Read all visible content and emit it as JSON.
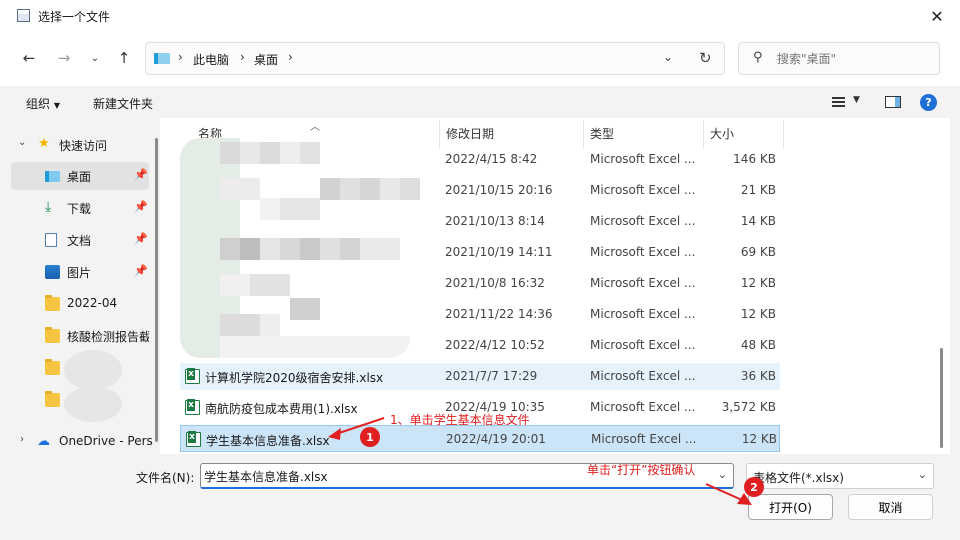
{
  "window": {
    "title": "选择一个文件"
  },
  "address": {
    "crumbs": [
      "此电脑",
      "桌面"
    ],
    "search_placeholder": "搜索\"桌面\""
  },
  "toolbar": {
    "organize": "组织",
    "new_folder": "新建文件夹"
  },
  "nav": {
    "quick_access": "快速访问",
    "items": [
      {
        "label": "桌面",
        "icon": "desktop-icon",
        "pinned": true
      },
      {
        "label": "下载",
        "icon": "download-icon",
        "pinned": true
      },
      {
        "label": "文档",
        "icon": "document-icon",
        "pinned": true
      },
      {
        "label": "图片",
        "icon": "picture-icon",
        "pinned": true
      },
      {
        "label": "2022-04",
        "icon": "folder-icon",
        "pinned": false
      },
      {
        "label": "核酸检测报告截",
        "icon": "folder-icon",
        "pinned": false
      }
    ],
    "onedrive": "OneDrive - Pers"
  },
  "columns": {
    "name": "名称",
    "date": "修改日期",
    "type": "类型",
    "size": "大小"
  },
  "files": [
    {
      "name": "",
      "date": "2022/4/15 8:42",
      "type": "Microsoft Excel ...",
      "size": "146 KB"
    },
    {
      "name": "",
      "date": "2021/10/15 20:16",
      "type": "Microsoft Excel ...",
      "size": "21 KB"
    },
    {
      "name": "",
      "date": "2021/10/13 8:14",
      "type": "Microsoft Excel ...",
      "size": "14 KB"
    },
    {
      "name": "",
      "date": "2021/10/19 14:11",
      "type": "Microsoft Excel ...",
      "size": "69 KB"
    },
    {
      "name": "",
      "date": "2021/10/8 16:32",
      "type": "Microsoft Excel ...",
      "size": "12 KB"
    },
    {
      "name": "",
      "date": "2021/11/22 14:36",
      "type": "Microsoft Excel ...",
      "size": "12 KB"
    },
    {
      "name": "",
      "date": "2022/4/12 10:52",
      "type": "Microsoft Excel ...",
      "size": "48 KB"
    },
    {
      "name": "计算机学院2020级宿舍安排.xlsx",
      "date": "2021/7/7 17:29",
      "type": "Microsoft Excel ...",
      "size": "36 KB"
    },
    {
      "name": "南航防疫包成本费用(1).xlsx",
      "date": "2022/4/19 10:35",
      "type": "Microsoft Excel ...",
      "size": "3,572 KB"
    },
    {
      "name": "学生基本信息准备.xlsx",
      "date": "2022/4/19 20:01",
      "type": "Microsoft Excel ...",
      "size": "12 KB"
    }
  ],
  "bottom": {
    "filename_label": "文件名(N):",
    "filename_value": "学生基本信息准备.xlsx",
    "filter_value": "表格文件(*.xlsx)",
    "open_label": "打开(O)",
    "cancel_label": "取消"
  },
  "annotations": {
    "step1_text": "1、单击学生基本信息文件",
    "step1_num": "1",
    "step2_text": "单击“打开”按钮确认",
    "step2_num": "2",
    "color": "#e02020"
  }
}
